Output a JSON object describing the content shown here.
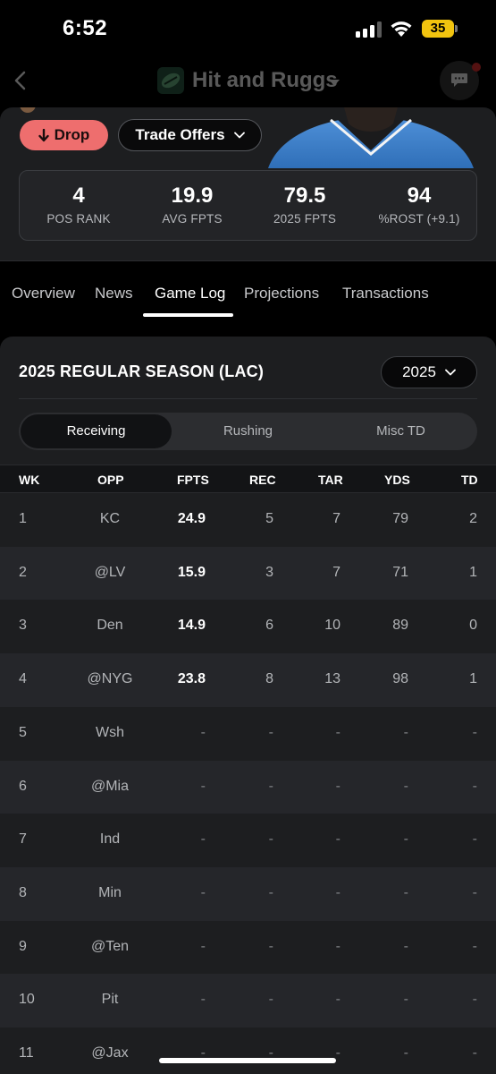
{
  "status_bar": {
    "time": "6:52",
    "battery": "35"
  },
  "header": {
    "team_name": "Hit and Ruggs"
  },
  "player": {
    "drop_label": "Drop",
    "trade_offers_label": "Trade Offers",
    "stats": [
      {
        "value": "4",
        "label": "POS RANK"
      },
      {
        "value": "19.9",
        "label": "AVG FPTS"
      },
      {
        "value": "79.5",
        "label": "2025 FPTS"
      },
      {
        "value": "94",
        "label": "%ROST (+9.1)"
      }
    ]
  },
  "tabs": [
    "Overview",
    "News",
    "Game Log",
    "Projections",
    "Transactions"
  ],
  "active_tab": "Game Log",
  "season": {
    "title": "2025 REGULAR SEASON (LAC)",
    "year": "2025",
    "segments": [
      "Receiving",
      "Rushing",
      "Misc TD"
    ],
    "active_segment": "Receiving"
  },
  "table": {
    "columns": [
      "WK",
      "OPP",
      "FPTS",
      "REC",
      "TAR",
      "YDS",
      "TD"
    ],
    "rows": [
      [
        "1",
        "KC",
        "24.9",
        "5",
        "7",
        "79",
        "2"
      ],
      [
        "2",
        "@LV",
        "15.9",
        "3",
        "7",
        "71",
        "1"
      ],
      [
        "3",
        "Den",
        "14.9",
        "6",
        "10",
        "89",
        "0"
      ],
      [
        "4",
        "@NYG",
        "23.8",
        "8",
        "13",
        "98",
        "1"
      ],
      [
        "5",
        "Wsh",
        "-",
        "-",
        "-",
        "-",
        "-"
      ],
      [
        "6",
        "@Mia",
        "-",
        "-",
        "-",
        "-",
        "-"
      ],
      [
        "7",
        "Ind",
        "-",
        "-",
        "-",
        "-",
        "-"
      ],
      [
        "8",
        "Min",
        "-",
        "-",
        "-",
        "-",
        "-"
      ],
      [
        "9",
        "@Ten",
        "-",
        "-",
        "-",
        "-",
        "-"
      ],
      [
        "10",
        "Pit",
        "-",
        "-",
        "-",
        "-",
        "-"
      ],
      [
        "11",
        "@Jax",
        "-",
        "-",
        "-",
        "-",
        "-"
      ]
    ]
  },
  "colors": {
    "drop": "#ee6e6e",
    "battery": "#f2c40f",
    "background": "#000000",
    "card": "#1d1e20"
  },
  "icons": [
    "back-arrow-icon",
    "team-logo-icon",
    "chat-icon",
    "drop-arrow-icon",
    "chevron-down-icon",
    "wifi-icon",
    "signal-icon",
    "battery-icon"
  ]
}
